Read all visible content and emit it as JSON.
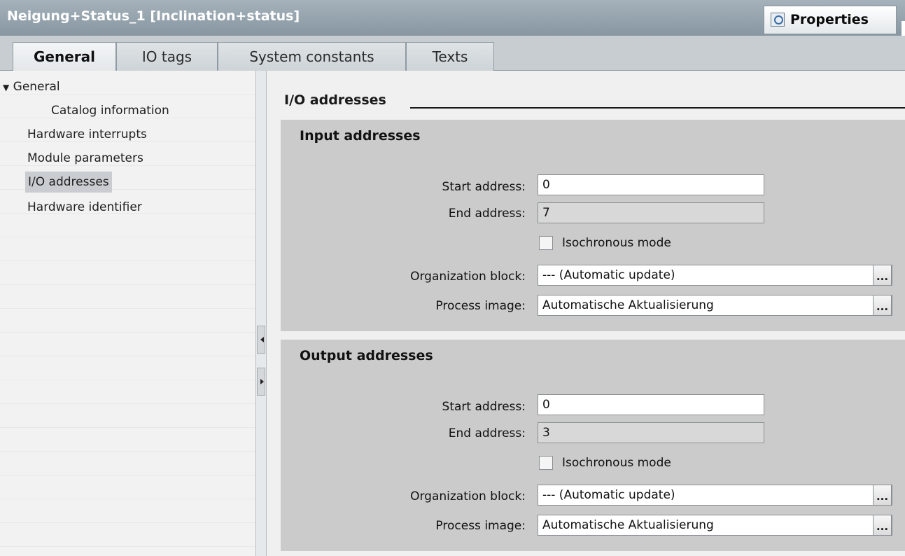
{
  "window": {
    "title": "Neigung+Status_1 [Inclination+status]"
  },
  "properties_button": {
    "label": "Properties",
    "icon": "magnifier-icon"
  },
  "tabs": [
    {
      "label": "General",
      "active": true
    },
    {
      "label": "IO tags",
      "active": false
    },
    {
      "label": "System constants",
      "active": false
    },
    {
      "label": "Texts",
      "active": false
    }
  ],
  "nav": {
    "items": [
      {
        "label": "General",
        "expanded": true,
        "icon": "expand-triangle-icon"
      },
      {
        "label": "Catalog information"
      },
      {
        "label": "Hardware interrupts"
      },
      {
        "label": "Module parameters"
      },
      {
        "label": "I/O addresses",
        "selected": true
      },
      {
        "label": "Hardware identifier"
      }
    ]
  },
  "main": {
    "section_title": "I/O addresses",
    "input": {
      "title": "Input addresses",
      "start_label": "Start address:",
      "start_value": "0",
      "end_label": "End address:",
      "end_value": "7",
      "iso_label": "Isochronous mode",
      "ob_label": "Organization block:",
      "ob_value": "--- (Automatic update)",
      "pi_label": "Process image:",
      "pi_value": "Automatische Aktualisierung",
      "dots": "..."
    },
    "output": {
      "title": "Output addresses",
      "start_label": "Start address:",
      "start_value": "0",
      "end_label": "End address:",
      "end_value": "3",
      "iso_label": "Isochronous mode",
      "ob_label": "Organization block:",
      "ob_value": "--- (Automatic update)",
      "pi_label": "Process image:",
      "pi_value": "Automatische Aktualisierung",
      "dots": "..."
    }
  }
}
